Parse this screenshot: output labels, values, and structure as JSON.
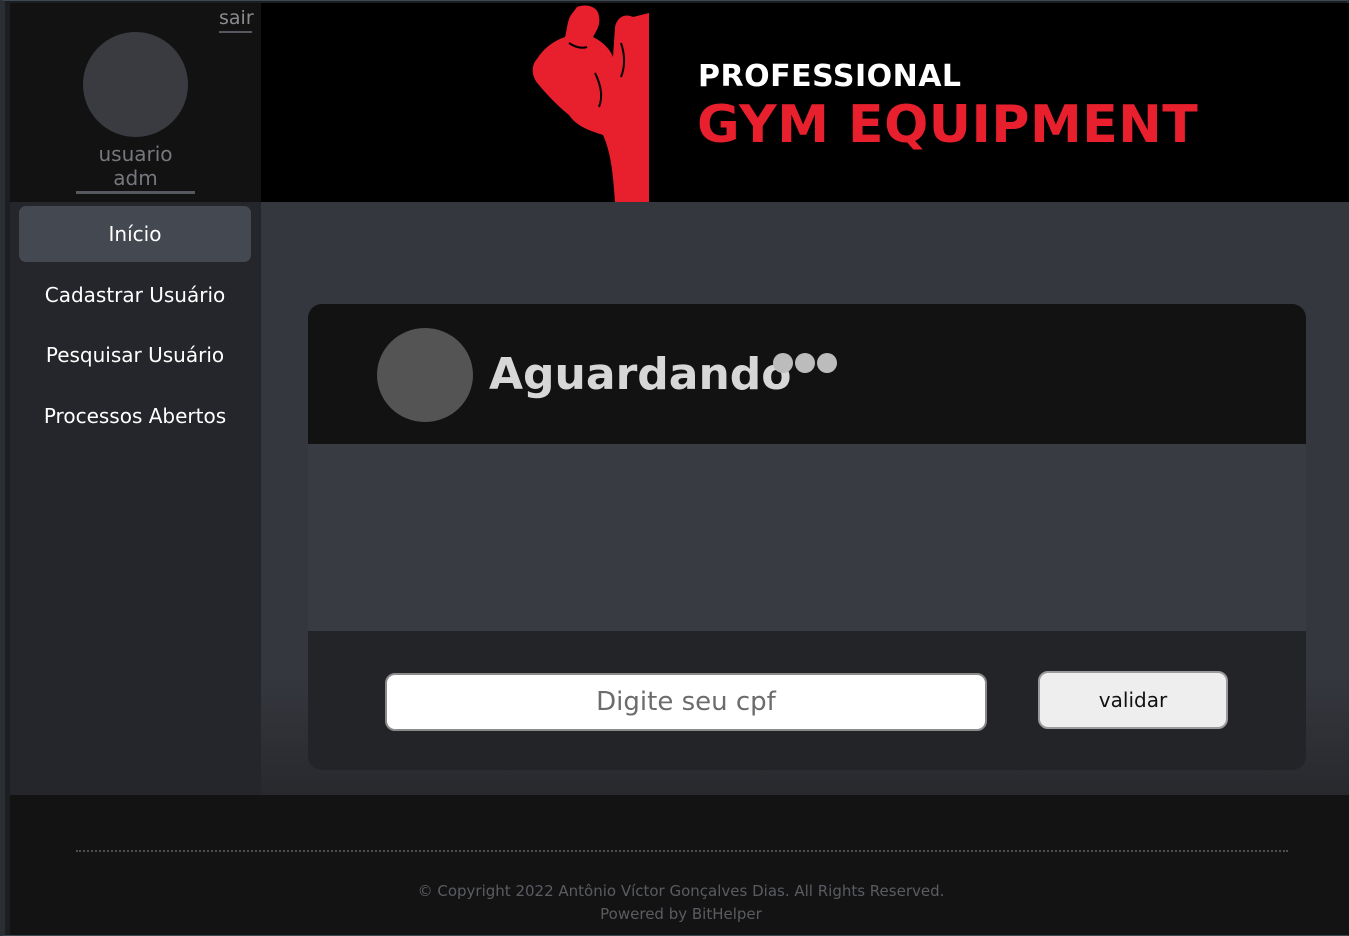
{
  "sidebar": {
    "logout_label": "sair",
    "username": "usuario adm",
    "items": [
      {
        "label": "Início",
        "active": true
      },
      {
        "label": "Cadastrar Usuário",
        "active": false
      },
      {
        "label": "Pesquisar Usuário",
        "active": false
      },
      {
        "label": "Processos Abertos",
        "active": false
      }
    ]
  },
  "banner": {
    "brand_top": "PROFESSIONAL",
    "brand_main": "GYM EQUIPMENT",
    "logo_icon": "bodybuilder-silhouette-icon",
    "accent_color": "#e8202e"
  },
  "status_card": {
    "status_text": "Aguardando",
    "dots_icon": "loading-dots-icon",
    "cpf_placeholder": "Digite seu cpf",
    "cpf_value": "",
    "validate_label": "validar"
  },
  "footer": {
    "copyright": "© Copyright 2022 Antônio Víctor Gonçalves Dias. All Rights Reserved.",
    "powered_by": "Powered by BitHelper"
  }
}
